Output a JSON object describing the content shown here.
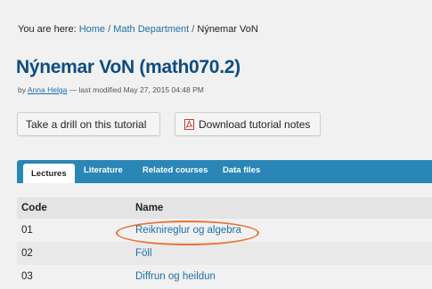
{
  "breadcrumb": {
    "prefix": "You are here: ",
    "items": [
      "Home",
      "Math Department",
      "Nýnemar VoN"
    ],
    "separator": " / "
  },
  "page": {
    "title": "Nýnemar VoN (math070.2)",
    "byline_prefix": "by ",
    "author": "Anna Helga",
    "modified": " — last modified May 27, 2015 04:48 PM"
  },
  "buttons": {
    "drill": "Take a drill on this tutorial",
    "download": "Download tutorial notes"
  },
  "tabs": [
    "Lectures",
    "Literature",
    "Related courses",
    "Data files"
  ],
  "table": {
    "headers": [
      "Code",
      "Name"
    ],
    "rows": [
      {
        "code": "01",
        "name": "Reiknireglur og algebra"
      },
      {
        "code": "02",
        "name": "Föll"
      },
      {
        "code": "03",
        "name": "Diffrun og heildun"
      }
    ]
  },
  "colors": {
    "title": "#0f4c81",
    "link": "#1f6fa8",
    "tabbar": "#2a86b6",
    "highlight": "#e8733a"
  },
  "icons": {
    "download": "pdf-icon"
  }
}
